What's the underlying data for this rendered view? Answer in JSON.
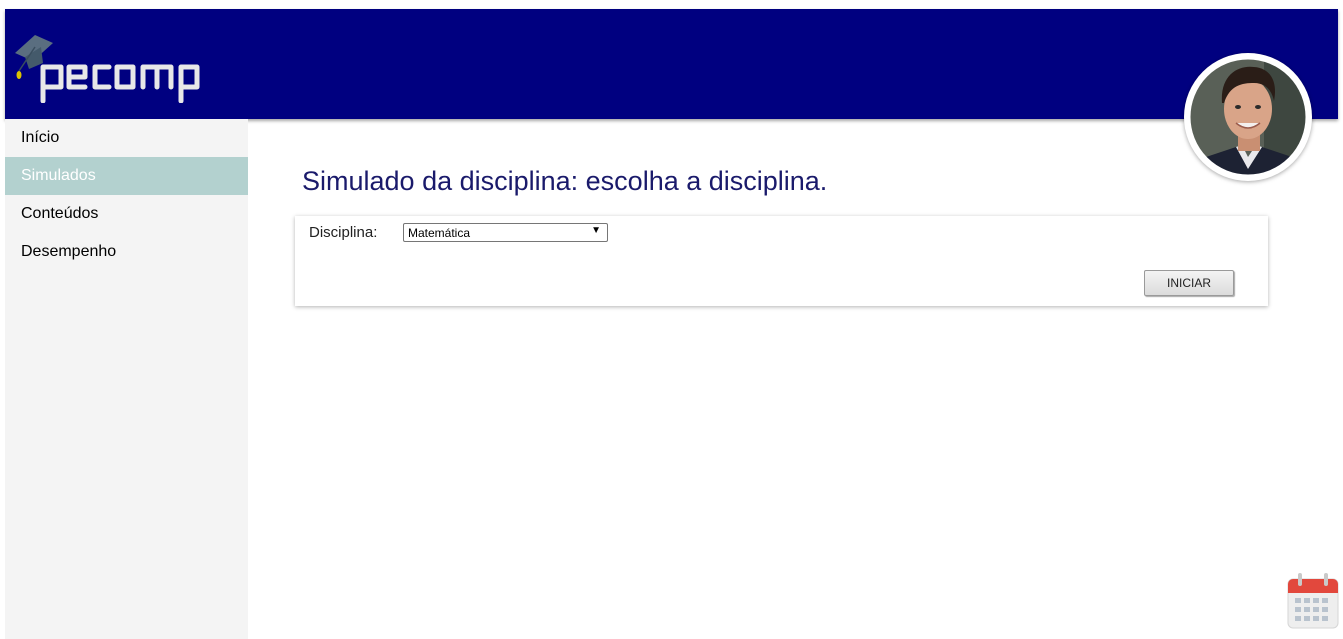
{
  "header": {
    "logo_text": "pecomp",
    "bg_color": "#000080"
  },
  "user": {
    "avatar_icon": "user-avatar-photo"
  },
  "sidebar": {
    "items": [
      {
        "label": "Início",
        "active": false
      },
      {
        "label": "Simulados",
        "active": true
      },
      {
        "label": "Conteúdos",
        "active": false
      },
      {
        "label": "Desempenho",
        "active": false
      }
    ],
    "active_color": "#b3d1cf"
  },
  "main": {
    "title": "Simulado da disciplina: escolha a disciplina.",
    "form": {
      "discipline_label": "Disciplina:",
      "discipline_value": "Matemática",
      "start_label": "INICIAR"
    }
  },
  "widgets": {
    "calendar_icon": "calendar-icon"
  }
}
